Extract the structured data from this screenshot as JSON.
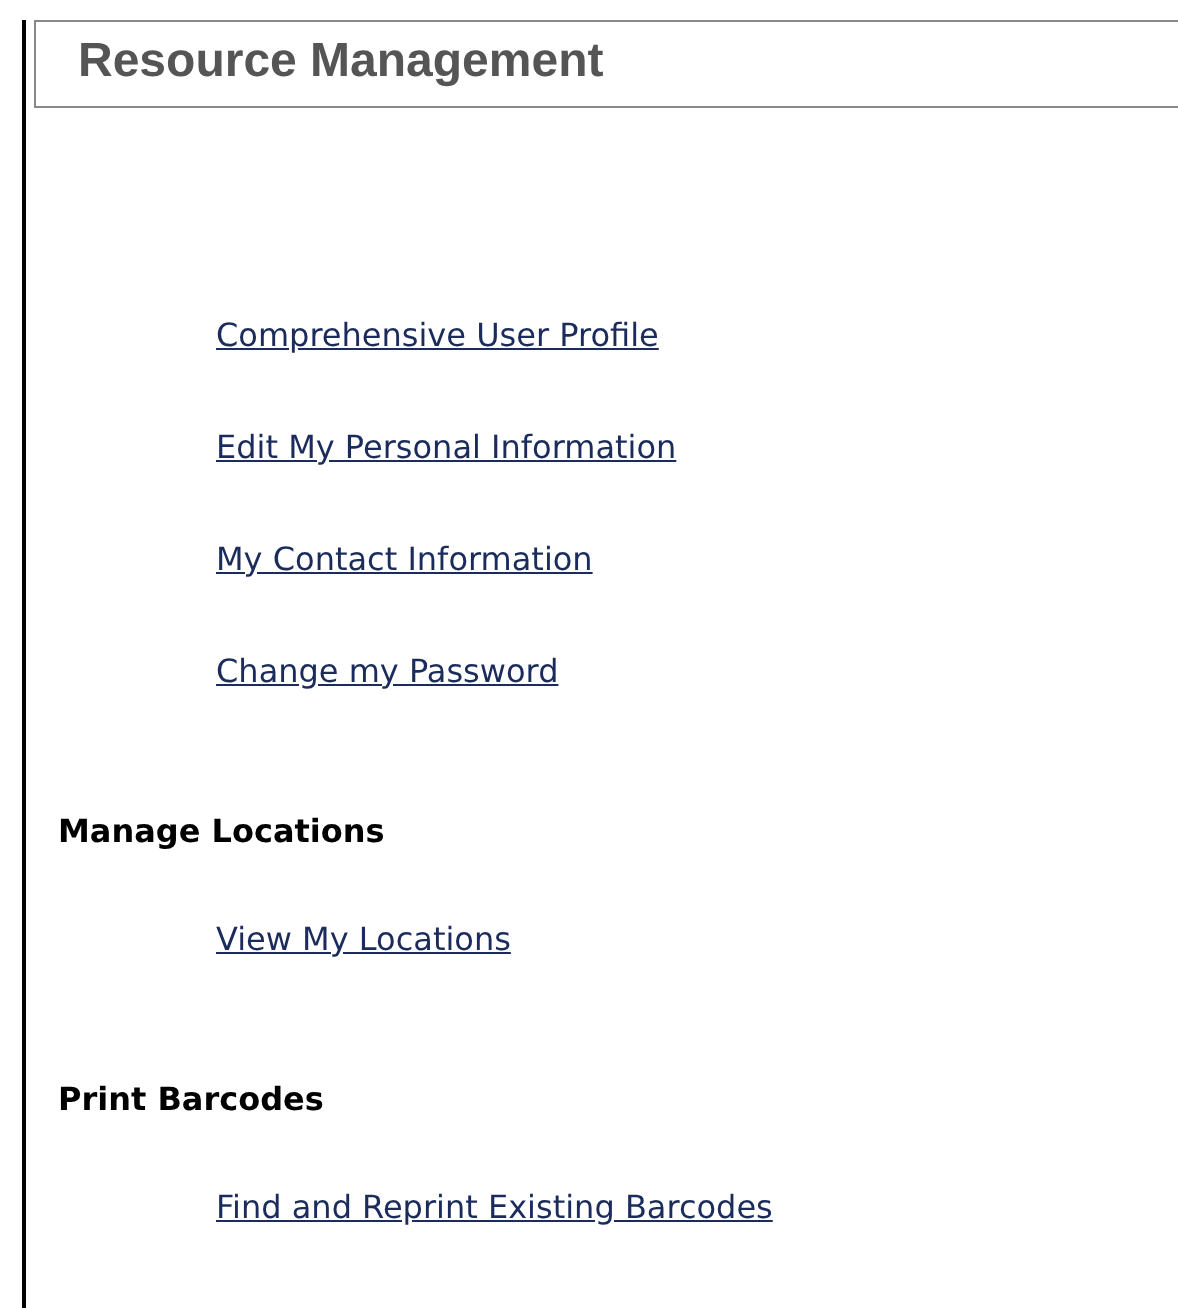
{
  "title": "Resource Management",
  "sections": [
    {
      "links": [
        "Comprehensive User Profile",
        "Edit My Personal Information",
        "My Contact Information",
        "Change my Password"
      ]
    },
    {
      "heading": "Manage Locations",
      "links": [
        "View My Locations"
      ]
    },
    {
      "heading": "Print Barcodes",
      "links": [
        "Find and Reprint Existing Barcodes"
      ]
    }
  ]
}
